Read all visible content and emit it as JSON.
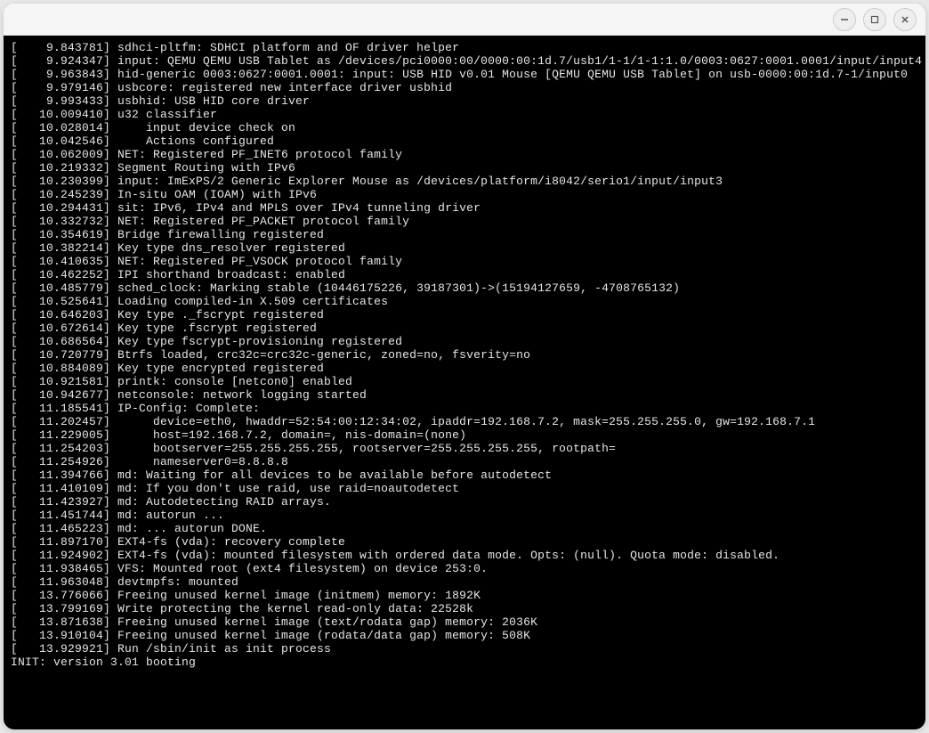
{
  "window": {
    "minimize": "—",
    "maximize": "□",
    "close": "×"
  },
  "lines": [
    "[    9.843781] sdhci-pltfm: SDHCI platform and OF driver helper",
    "[    9.924347] input: QEMU QEMU USB Tablet as /devices/pci0000:00/0000:00:1d.7/usb1/1-1/1-1:1.0/0003:0627:0001.0001/input/input4",
    "[    9.963843] hid-generic 0003:0627:0001.0001: input: USB HID v0.01 Mouse [QEMU QEMU USB Tablet] on usb-0000:00:1d.7-1/input0",
    "[    9.979146] usbcore: registered new interface driver usbhid",
    "[    9.993433] usbhid: USB HID core driver",
    "[   10.009410] u32 classifier",
    "[   10.028014]     input device check on",
    "[   10.042546]     Actions configured",
    "[   10.062009] NET: Registered PF_INET6 protocol family",
    "[   10.219332] Segment Routing with IPv6",
    "[   10.230399] input: ImExPS/2 Generic Explorer Mouse as /devices/platform/i8042/serio1/input/input3",
    "[   10.245239] In-situ OAM (IOAM) with IPv6",
    "[   10.294431] sit: IPv6, IPv4 and MPLS over IPv4 tunneling driver",
    "[   10.332732] NET: Registered PF_PACKET protocol family",
    "[   10.354619] Bridge firewalling registered",
    "[   10.382214] Key type dns_resolver registered",
    "[   10.410635] NET: Registered PF_VSOCK protocol family",
    "[   10.462252] IPI shorthand broadcast: enabled",
    "[   10.485779] sched_clock: Marking stable (10446175226, 39187301)->(15194127659, -4708765132)",
    "[   10.525641] Loading compiled-in X.509 certificates",
    "[   10.646203] Key type ._fscrypt registered",
    "[   10.672614] Key type .fscrypt registered",
    "[   10.686564] Key type fscrypt-provisioning registered",
    "[   10.720779] Btrfs loaded, crc32c=crc32c-generic, zoned=no, fsverity=no",
    "[   10.884089] Key type encrypted registered",
    "[   10.921581] printk: console [netcon0] enabled",
    "[   10.942677] netconsole: network logging started",
    "[   11.185541] IP-Config: Complete:",
    "[   11.202457]      device=eth0, hwaddr=52:54:00:12:34:02, ipaddr=192.168.7.2, mask=255.255.255.0, gw=192.168.7.1",
    "[   11.229005]      host=192.168.7.2, domain=, nis-domain=(none)",
    "[   11.254203]      bootserver=255.255.255.255, rootserver=255.255.255.255, rootpath=",
    "[   11.254926]      nameserver0=8.8.8.8",
    "[   11.394766] md: Waiting for all devices to be available before autodetect",
    "[   11.410109] md: If you don't use raid, use raid=noautodetect",
    "[   11.423927] md: Autodetecting RAID arrays.",
    "[   11.451744] md: autorun ...",
    "[   11.465223] md: ... autorun DONE.",
    "[   11.897170] EXT4-fs (vda): recovery complete",
    "[   11.924902] EXT4-fs (vda): mounted filesystem with ordered data mode. Opts: (null). Quota mode: disabled.",
    "[   11.938465] VFS: Mounted root (ext4 filesystem) on device 253:0.",
    "[   11.963048] devtmpfs: mounted",
    "[   13.776066] Freeing unused kernel image (initmem) memory: 1892K",
    "[   13.799169] Write protecting the kernel read-only data: 22528k",
    "[   13.871638] Freeing unused kernel image (text/rodata gap) memory: 2036K",
    "[   13.910104] Freeing unused kernel image (rodata/data gap) memory: 508K",
    "[   13.929921] Run /sbin/init as init process",
    "INIT: version 3.01 booting"
  ]
}
